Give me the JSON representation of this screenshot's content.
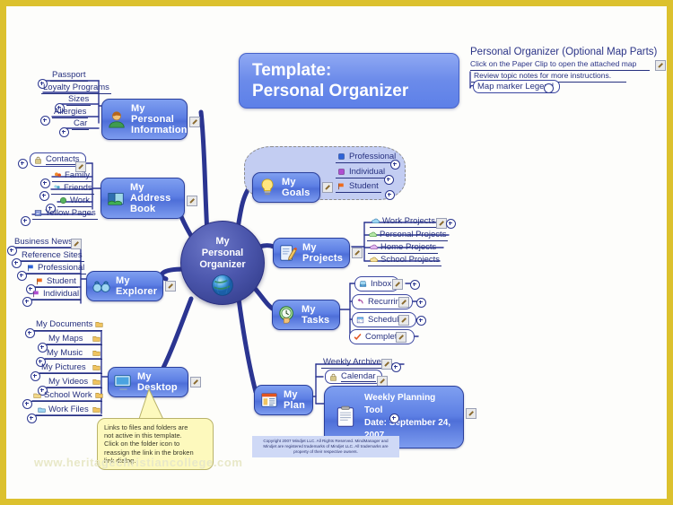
{
  "document": {
    "title_line1": "Template:",
    "title_line2": "Personal Organizer",
    "watermark": "www.heritagechristiancollege.com",
    "copyright": "Copyright 2007 Mindjet LLC.  All Rights Reserved. MindManager and Mindjet are registered trademarks of Mindjet LLC. All trademarks are property of their respective owners.",
    "border_color": "#dcc12e",
    "accent_color": "#2a3f9b"
  },
  "legend": {
    "heading": "Personal Organizer (Optional Map Parts)",
    "subheading": "Click on the Paper Clip to open the attached map",
    "note": "Review topic notes for more instructions.",
    "marker_legend": "Map marker Legend"
  },
  "central": {
    "line1": "My",
    "line2": "Personal",
    "line3": "Organizer",
    "icon": "globe-icon"
  },
  "branches": [
    {
      "id": "personal-information",
      "label": "My Personal\nInformation",
      "label_line1": "My Personal",
      "label_line2": "Information",
      "icon": "person-icon",
      "children": [
        {
          "label": "Passport",
          "icon": null
        },
        {
          "label": "Loyalty Programs",
          "icon": null
        },
        {
          "label": "Sizes",
          "icon": null
        },
        {
          "label": "Allergies",
          "icon": null
        },
        {
          "label": "Car",
          "icon": null
        }
      ]
    },
    {
      "id": "address-book",
      "label_line1": "My Address",
      "label_line2": "Book",
      "icon": "address-book-icon",
      "children": [
        {
          "label": "Contacts",
          "icon": "lock-icon",
          "boxed": true
        },
        {
          "label": "Family",
          "icon": "family-icon"
        },
        {
          "label": "Friends",
          "icon": "friends-icon"
        },
        {
          "label": "Work",
          "icon": "work-icon"
        },
        {
          "label": "Yellow Pages",
          "icon": "yellow-pages-icon"
        }
      ]
    },
    {
      "id": "explorer",
      "label_line1": "My Explorer",
      "icon": "binoculars-icon",
      "children": [
        {
          "label": "Business News",
          "icon": null
        },
        {
          "label": "Reference Sites",
          "icon": null
        },
        {
          "label": "Professional",
          "icon": "flag-blue-icon"
        },
        {
          "label": "Student",
          "icon": "flag-orange-icon"
        },
        {
          "label": "Individual",
          "icon": "flag-purple-icon"
        }
      ]
    },
    {
      "id": "desktop",
      "label_line1": "My Desktop",
      "icon": "monitor-icon",
      "children": [
        {
          "label": "My Documents",
          "icon": "folder-icon"
        },
        {
          "label": "My Maps",
          "icon": "folder-icon"
        },
        {
          "label": "My Music",
          "icon": "folder-icon"
        },
        {
          "label": "My Pictures",
          "icon": "folder-icon"
        },
        {
          "label": "My Videos",
          "icon": "folder-icon"
        },
        {
          "label": "School Work",
          "icon": "folder-yellow-icon"
        },
        {
          "label": "Work Files",
          "icon": "folder-blue-icon"
        }
      ]
    },
    {
      "id": "goals",
      "label_line1": "My Goals",
      "icon": "lightbulb-icon",
      "children": [
        {
          "label": "Professional",
          "icon": "square-blue-icon"
        },
        {
          "label": "Individual",
          "icon": "square-purple-icon"
        },
        {
          "label": "Student",
          "icon": "flag-orange-icon"
        }
      ]
    },
    {
      "id": "projects",
      "label_line1": "My Projects",
      "icon": "notepad-pencil-icon",
      "children": [
        {
          "label": "Work Projects",
          "icon": "cloud-blue-icon"
        },
        {
          "label": "Personal Projects",
          "icon": "cloud-green-icon"
        },
        {
          "label": "Home Projects",
          "icon": "cloud-purple-icon"
        },
        {
          "label": "School Projects",
          "icon": "cloud-yellow-icon"
        }
      ]
    },
    {
      "id": "tasks",
      "label_line1": "My Tasks",
      "icon": "clock-hand-icon",
      "children": [
        {
          "label": "Inbox",
          "icon": "inbox-icon"
        },
        {
          "label": "Recurring",
          "icon": "recurring-arrow-icon"
        },
        {
          "label": "Scheduled",
          "icon": "calendar-icon"
        },
        {
          "label": "Completed",
          "icon": "check-icon"
        }
      ]
    },
    {
      "id": "plan",
      "label_line1": "My Plan",
      "icon": "planner-icon",
      "children": [
        {
          "label": "Weekly Archives",
          "icon": null
        },
        {
          "label": "Calendar",
          "icon": "lock-icon",
          "boxed": true
        }
      ]
    }
  ],
  "planning_tool": {
    "line1": "Weekly Planning Tool",
    "line2": "Date:  September 24, 2007",
    "icon": "clipboard-icon"
  },
  "callout": {
    "line1": "Links to files and folders are",
    "line2": "not active in this template.",
    "line3": "Click on the folder icon to",
    "line4": "reassign the link in the broken",
    "line5": "link dialog."
  }
}
